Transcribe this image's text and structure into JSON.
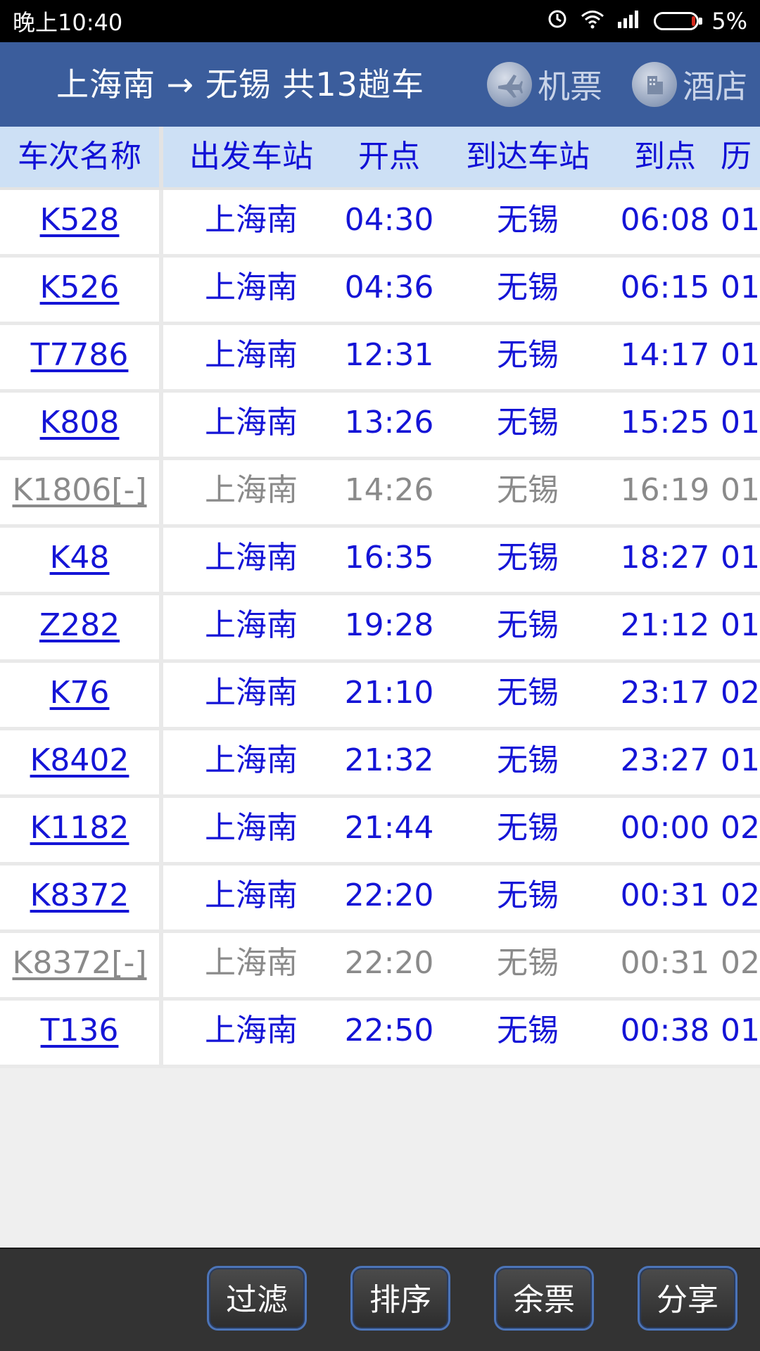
{
  "status_bar": {
    "time": "晚上10:40",
    "battery": "5%",
    "icons": [
      "alarm-icon",
      "wifi-icon",
      "signal-icon",
      "battery-icon"
    ]
  },
  "header": {
    "title": "上海南 → 无锡 共13趟车",
    "flight_label": "机票",
    "hotel_label": "酒店"
  },
  "table": {
    "headers": [
      "车次名称",
      "出发车站",
      "开点",
      "到达车站",
      "到点",
      "历"
    ],
    "rows": [
      {
        "train": "K528",
        "from": "上海南",
        "dep": "04:30",
        "to": "无锡",
        "arr": "06:08",
        "dur": "01",
        "available": true
      },
      {
        "train": "K526",
        "from": "上海南",
        "dep": "04:36",
        "to": "无锡",
        "arr": "06:15",
        "dur": "01",
        "available": true
      },
      {
        "train": "T7786",
        "from": "上海南",
        "dep": "12:31",
        "to": "无锡",
        "arr": "14:17",
        "dur": "01",
        "available": true
      },
      {
        "train": "K808",
        "from": "上海南",
        "dep": "13:26",
        "to": "无锡",
        "arr": "15:25",
        "dur": "01",
        "available": true
      },
      {
        "train": "K1806[-]",
        "from": "上海南",
        "dep": "14:26",
        "to": "无锡",
        "arr": "16:19",
        "dur": "01",
        "available": false
      },
      {
        "train": "K48",
        "from": "上海南",
        "dep": "16:35",
        "to": "无锡",
        "arr": "18:27",
        "dur": "01",
        "available": true
      },
      {
        "train": "Z282",
        "from": "上海南",
        "dep": "19:28",
        "to": "无锡",
        "arr": "21:12",
        "dur": "01",
        "available": true
      },
      {
        "train": "K76",
        "from": "上海南",
        "dep": "21:10",
        "to": "无锡",
        "arr": "23:17",
        "dur": "02",
        "available": true
      },
      {
        "train": "K8402",
        "from": "上海南",
        "dep": "21:32",
        "to": "无锡",
        "arr": "23:27",
        "dur": "01",
        "available": true
      },
      {
        "train": "K1182",
        "from": "上海南",
        "dep": "21:44",
        "to": "无锡",
        "arr": "00:00",
        "dur": "02",
        "available": true
      },
      {
        "train": "K8372",
        "from": "上海南",
        "dep": "22:20",
        "to": "无锡",
        "arr": "00:31",
        "dur": "02",
        "available": true
      },
      {
        "train": "K8372[-]",
        "from": "上海南",
        "dep": "22:20",
        "to": "无锡",
        "arr": "00:31",
        "dur": "02",
        "available": false
      },
      {
        "train": "T136",
        "from": "上海南",
        "dep": "22:50",
        "to": "无锡",
        "arr": "00:38",
        "dur": "01",
        "available": true
      }
    ]
  },
  "bottom_bar": {
    "filter_label": "过滤",
    "sort_label": "排序",
    "tickets_label": "余票",
    "share_label": "分享"
  },
  "colors": {
    "header_bg": "#3b5d9c",
    "table_header_bg": "#cde0f5",
    "link_blue": "#1414d6",
    "disabled_gray": "#8a8a8a",
    "bottom_bar_bg": "#333333"
  }
}
